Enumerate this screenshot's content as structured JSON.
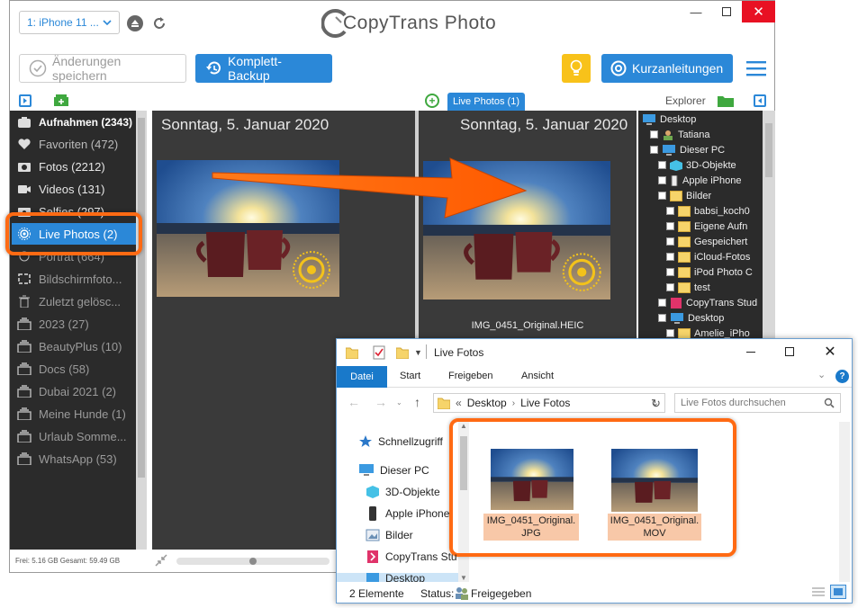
{
  "app": {
    "device": "1: iPhone 11 ...",
    "title": "CopyTrans Photo",
    "save_label": "Änderungen speichern",
    "backup_label": "Komplett-Backup",
    "guides_label": "Kurzanleitungen",
    "explorer_label": "Explorer",
    "tab_live": "Live Photos (1)",
    "date_left": "Sonntag, 5. Januar 2020",
    "date_right": "Sonntag, 5. Januar 2020",
    "photo_caption": "IMG_0451_Original.HEIC",
    "status_space": "Frei: 5.16 GB Gesamt: 59.49 GB",
    "sidebar": [
      {
        "label": "Aufnahmen (2343)",
        "icon": "camera-roll-icon"
      },
      {
        "label": "Favoriten (472)",
        "icon": "heart-icon"
      },
      {
        "label": "Fotos (2212)",
        "icon": "camera-icon"
      },
      {
        "label": "Videos (131)",
        "icon": "video-icon"
      },
      {
        "label": "Selfies (297)",
        "icon": "selfie-icon"
      },
      {
        "label": "Live Photos (2)",
        "icon": "live-photo-icon"
      },
      {
        "label": "Porträt (664)",
        "icon": "portrait-icon"
      },
      {
        "label": "Bildschirmfoto...",
        "icon": "screenshot-icon"
      },
      {
        "label": "Zuletzt gelösc...",
        "icon": "trash-icon"
      },
      {
        "label": "2023 (27)",
        "icon": "album-icon"
      },
      {
        "label": "BeautyPlus (10)",
        "icon": "album-icon"
      },
      {
        "label": "Docs (58)",
        "icon": "album-icon"
      },
      {
        "label": "Dubai 2021 (2)",
        "icon": "album-icon"
      },
      {
        "label": "Meine Hunde (1)",
        "icon": "album-icon"
      },
      {
        "label": "Urlaub Somme...",
        "icon": "album-icon"
      },
      {
        "label": "WhatsApp (53)",
        "icon": "album-icon"
      }
    ],
    "tree": [
      {
        "label": "Desktop",
        "level": 0
      },
      {
        "label": "Tatiana",
        "level": 1
      },
      {
        "label": "Dieser PC",
        "level": 1
      },
      {
        "label": "3D-Objekte",
        "level": 2
      },
      {
        "label": "Apple iPhone",
        "level": 2
      },
      {
        "label": "Bilder",
        "level": 2
      },
      {
        "label": "babsi_koch0",
        "level": 3
      },
      {
        "label": "Eigene Aufn",
        "level": 3
      },
      {
        "label": "Gespeichert",
        "level": 3
      },
      {
        "label": "iCloud-Fotos",
        "level": 3
      },
      {
        "label": "iPod Photo C",
        "level": 3
      },
      {
        "label": "test",
        "level": 3
      },
      {
        "label": "CopyTrans Stud",
        "level": 2
      },
      {
        "label": "Desktop",
        "level": 2
      },
      {
        "label": "Amelie_iPho",
        "level": 3
      }
    ]
  },
  "explorer": {
    "title": "Live Fotos",
    "ribbon": [
      "Datei",
      "Start",
      "Freigeben",
      "Ansicht"
    ],
    "path_prefix": "«",
    "path": [
      "Desktop",
      "Live Fotos"
    ],
    "search_placeholder": "Live Fotos durchsuchen",
    "nav": [
      {
        "label": "Schnellzugriff",
        "icon": "star-icon"
      },
      {
        "label": "Dieser PC",
        "icon": "computer-icon"
      },
      {
        "label": "3D-Objekte",
        "icon": "cube-icon"
      },
      {
        "label": "Apple iPhone",
        "icon": "phone-icon"
      },
      {
        "label": "Bilder",
        "icon": "pictures-icon"
      },
      {
        "label": "CopyTrans Stu",
        "icon": "copytrans-icon"
      },
      {
        "label": "Desktop",
        "icon": "desktop-icon"
      }
    ],
    "files": [
      {
        "name": "IMG_0451_Original.JPG"
      },
      {
        "name": "IMG_0451_Original.MOV"
      }
    ],
    "status_count": "2 Elemente",
    "status_label": "Status:",
    "status_value": "Freigegeben"
  },
  "colors": {
    "accent_blue": "#2b88d8",
    "highlight_orange": "#ff6a13",
    "dark_bg": "#2b2b2b",
    "file_highlight": "#f8c8a8"
  }
}
